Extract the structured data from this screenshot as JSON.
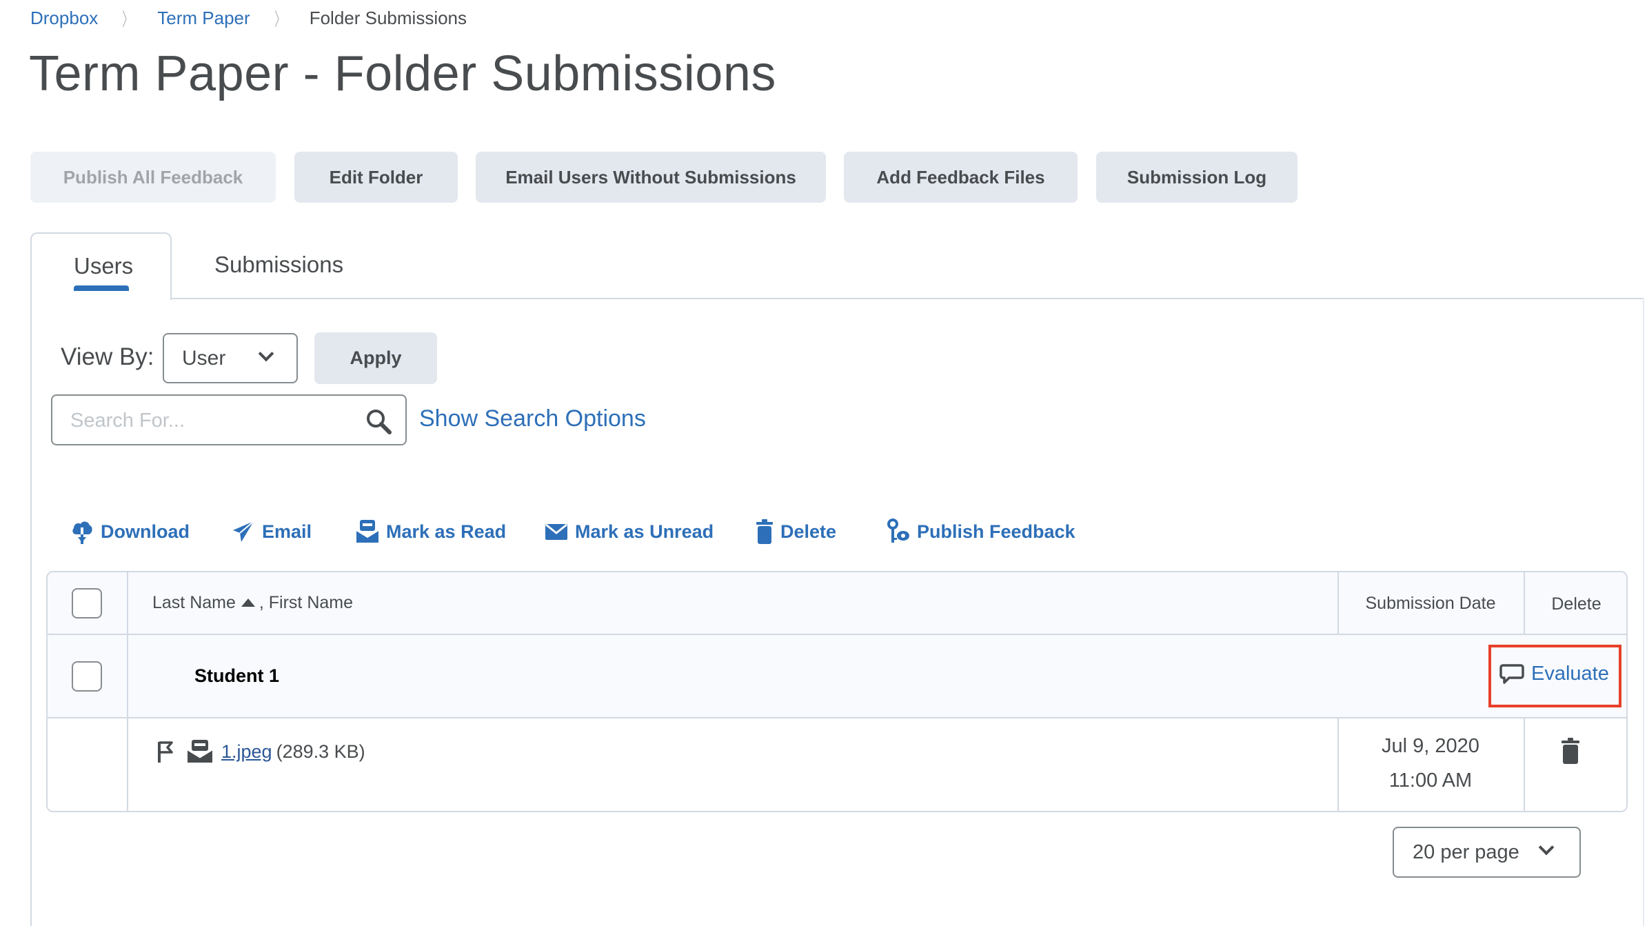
{
  "breadcrumb": {
    "items": [
      {
        "label": "Dropbox"
      },
      {
        "label": "Term Paper"
      }
    ],
    "current": "Folder Submissions"
  },
  "page_title": "Term Paper - Folder Submissions",
  "buttons": {
    "publish_all_feedback": "Publish All Feedback",
    "edit_folder": "Edit Folder",
    "email_users_without_submissions": "Email Users Without Submissions",
    "add_feedback_files": "Add Feedback Files",
    "submission_log": "Submission Log"
  },
  "tabs": [
    {
      "label": "Users",
      "active": true
    },
    {
      "label": "Submissions",
      "active": false
    }
  ],
  "view_by": {
    "label": "View By:",
    "selected": "User",
    "apply_label": "Apply"
  },
  "search": {
    "placeholder": "Search For...",
    "value": "",
    "show_options_label": "Show Search Options"
  },
  "actions": [
    {
      "label": "Download",
      "icon": "download-cloud-icon"
    },
    {
      "label": "Email",
      "icon": "paper-plane-icon"
    },
    {
      "label": "Mark as Read",
      "icon": "envelope-open-icon"
    },
    {
      "label": "Mark as Unread",
      "icon": "envelope-icon"
    },
    {
      "label": "Delete",
      "icon": "trash-icon"
    },
    {
      "label": "Publish Feedback",
      "icon": "publish-feedback-icon"
    }
  ],
  "table": {
    "columns": {
      "name_last": "Last Name",
      "name_sep": ", First Name",
      "sort": "ascending",
      "submission_date": "Submission Date",
      "delete": "Delete"
    },
    "rows": [
      {
        "student": "Student 1",
        "evaluate_label": "Evaluate",
        "files": [
          {
            "name": "1.jpeg",
            "size": "(289.3 KB)",
            "date": "Jul 9, 2020",
            "time": "11:00 AM"
          }
        ]
      }
    ]
  },
  "pagination": {
    "per_page": "20 per page"
  },
  "colors": {
    "link": "#2d6fb8",
    "text": "#494c4e",
    "button_bg": "#e3e7ee",
    "highlight_box": "#e8402a"
  }
}
